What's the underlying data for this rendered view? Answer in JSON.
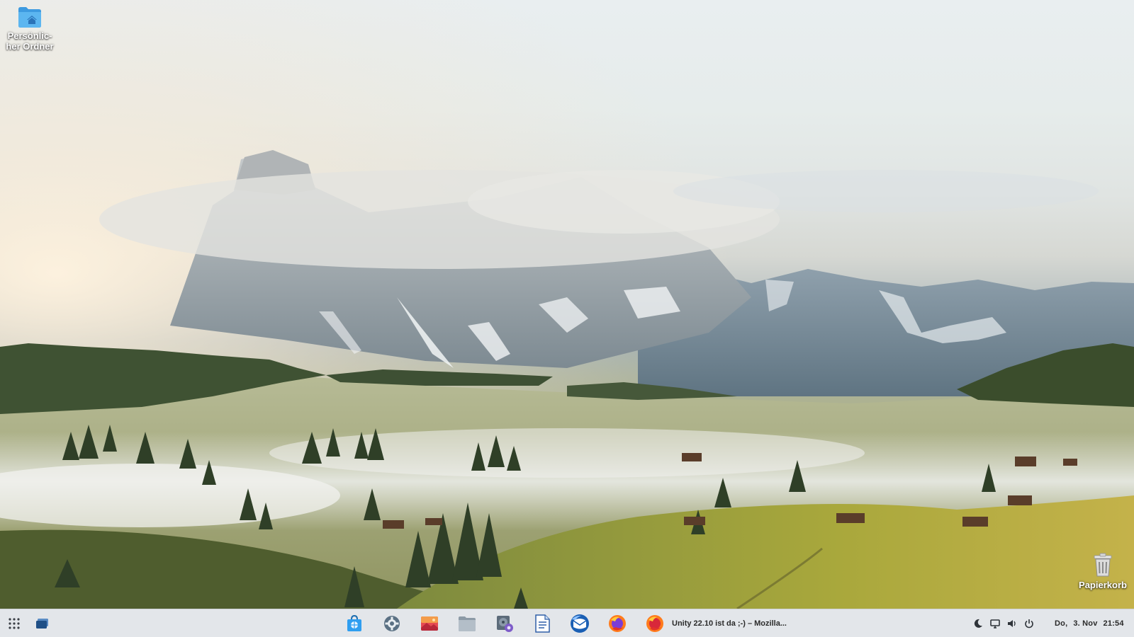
{
  "desktop": {
    "home_folder": {
      "label": "Persönlic-her Ordner",
      "label_line1": "Persönlic-",
      "label_line2": "her Ordner",
      "icon": "home-folder-icon"
    },
    "trash": {
      "label": "Papierkorb",
      "icon": "trash-icon"
    }
  },
  "taskbar": {
    "left": [
      {
        "name": "app-grid",
        "icon": "app-grid-icon"
      },
      {
        "name": "show-desktop",
        "icon": "window-icon"
      }
    ],
    "apps": [
      {
        "name": "software-store",
        "icon": "store-bag-icon"
      },
      {
        "name": "settings",
        "icon": "gear-icon"
      },
      {
        "name": "image-viewer",
        "icon": "photo-icon"
      },
      {
        "name": "file-manager",
        "icon": "folder-icon"
      },
      {
        "name": "disk-utility",
        "icon": "disk-gear-icon"
      },
      {
        "name": "text-editor",
        "icon": "document-icon"
      },
      {
        "name": "mail-client",
        "icon": "thunderbird-icon"
      },
      {
        "name": "firefox",
        "icon": "firefox-icon"
      },
      {
        "name": "firefox-window",
        "icon": "firefox-icon"
      }
    ],
    "active_task_title": "Unity 22.10 ist da ;-) – Mozilla...",
    "tray": [
      {
        "name": "night-light",
        "icon": "moon-icon"
      },
      {
        "name": "display",
        "icon": "monitor-icon"
      },
      {
        "name": "volume",
        "icon": "speaker-icon"
      },
      {
        "name": "power",
        "icon": "power-icon"
      }
    ],
    "clock": {
      "day": "Do,",
      "date": "3. Nov",
      "time": "21:54"
    }
  },
  "colors": {
    "taskbar_bg": "#e3e6ea",
    "folder_blue": "#4aa8e8",
    "firefox_orange": "#ff7b1c"
  }
}
